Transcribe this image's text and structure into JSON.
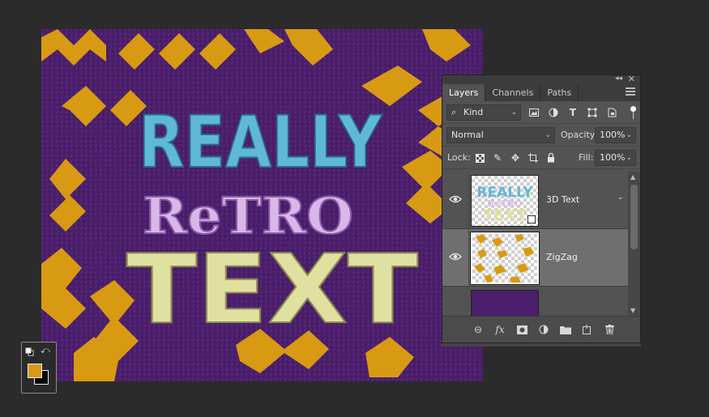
{
  "panel": {
    "tabs": [
      "Layers",
      "Channels",
      "Paths"
    ],
    "filter_kind": "Kind",
    "blend_mode": "Normal",
    "opacity_label": "Opacity:",
    "opacity_value": "100%",
    "lock_label": "Lock:",
    "fill_label": "Fill:",
    "fill_value": "100%",
    "layers": [
      {
        "name": "3D Text",
        "selected": false
      },
      {
        "name": "ZigZag",
        "selected": true
      },
      {
        "name": "",
        "selected": false
      }
    ]
  },
  "artwork": {
    "line1": "REALLY",
    "line2": "ReTRO",
    "line3": "TEXT",
    "colors": {
      "background": "#4a1e6a",
      "zigzag": "#d89a13",
      "line1": "#5fb8d8",
      "line2": "#d9b8e8",
      "line3": "#e0e0a0"
    }
  },
  "swatches": {
    "foreground": "#d89a13",
    "background": "#000000"
  },
  "icons": [
    "collapse-icon",
    "close-icon",
    "panel-menu-icon",
    "search-icon",
    "image-filter-icon",
    "adjustment-filter-icon",
    "type-filter-icon",
    "shape-filter-icon",
    "smartobject-filter-icon",
    "filter-toggle",
    "lock-transparent-icon",
    "lock-image-icon",
    "lock-position-icon",
    "lock-artboard-icon",
    "lock-all-icon",
    "eye-icon",
    "link-icon",
    "fx-icon",
    "mask-icon",
    "adjustment-icon",
    "folder-icon",
    "new-layer-icon",
    "trash-icon"
  ]
}
